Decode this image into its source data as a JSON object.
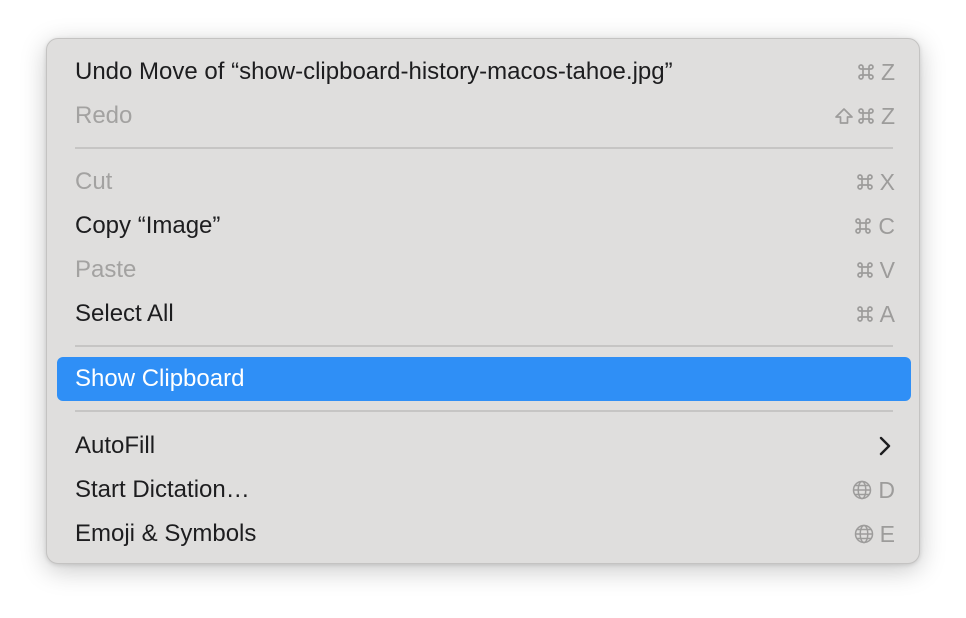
{
  "menu": {
    "items": [
      {
        "label": "Undo Move of “show-clipboard-history-macos-tahoe.jpg”",
        "mods": [
          "cmd"
        ],
        "key": "Z",
        "enabled": true
      },
      {
        "label": "Redo",
        "mods": [
          "shift",
          "cmd"
        ],
        "key": "Z",
        "enabled": false
      },
      {
        "label": "Cut",
        "mods": [
          "cmd"
        ],
        "key": "X",
        "enabled": false
      },
      {
        "label": "Copy “Image”",
        "mods": [
          "cmd"
        ],
        "key": "C",
        "enabled": true
      },
      {
        "label": "Paste",
        "mods": [
          "cmd"
        ],
        "key": "V",
        "enabled": false
      },
      {
        "label": "Select All",
        "mods": [
          "cmd"
        ],
        "key": "A",
        "enabled": true
      },
      {
        "label": "Show Clipboard",
        "enabled": true,
        "highlighted": true
      },
      {
        "label": "AutoFill",
        "enabled": true,
        "submenu": true
      },
      {
        "label": "Start Dictation…",
        "mods": [
          "globe"
        ],
        "key": "D",
        "enabled": true
      },
      {
        "label": "Emoji & Symbols",
        "mods": [
          "globe"
        ],
        "key": "E",
        "enabled": true
      }
    ]
  },
  "icons": {
    "cmd": "command-key-icon",
    "shift": "shift-key-icon",
    "globe": "globe-key-icon",
    "submenu": "chevron-right-icon"
  },
  "colors": {
    "menu_background": "#dfdedd",
    "highlight": "#2f8ff6",
    "text": "#1d1d1f",
    "disabled_text": "#a3a2a1",
    "shortcut_text": "#9d9c9b",
    "separator": "#c6c5c4"
  }
}
